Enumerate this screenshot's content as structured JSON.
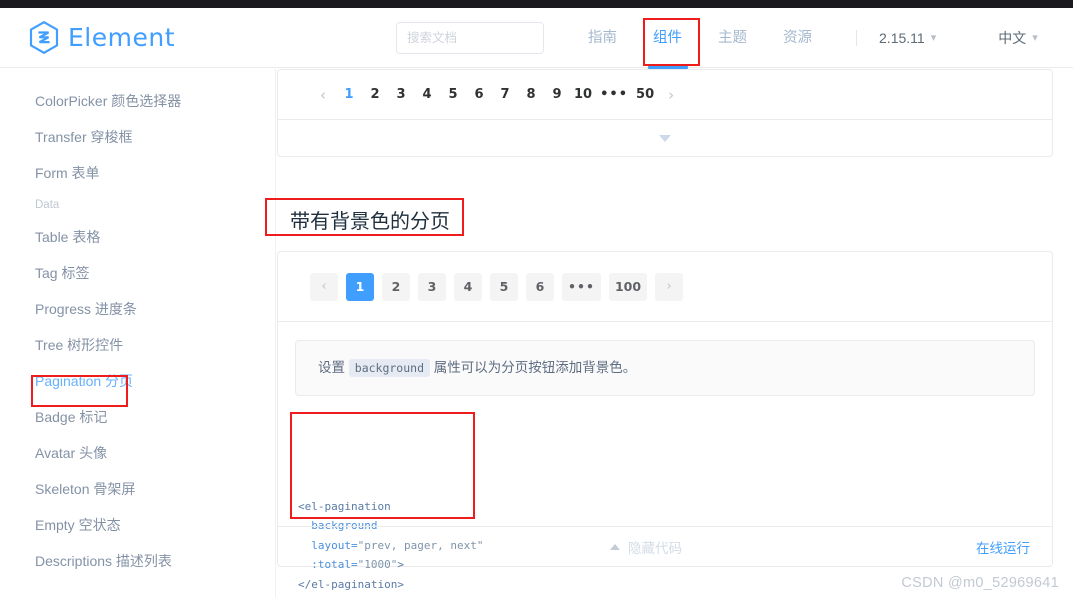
{
  "header": {
    "brand_name": "Element",
    "brand_logo_icon": "element-hexagon-logo-icon",
    "search_placeholder": "搜索文档",
    "search_value": "",
    "nav_links": [
      {
        "label": "指南",
        "active": false
      },
      {
        "label": "组件",
        "active": true
      },
      {
        "label": "主题",
        "active": false
      },
      {
        "label": "资源",
        "active": false
      }
    ],
    "version": "2.15.11",
    "language": "中文",
    "caret_icon": "chevron-down-icon"
  },
  "sidebar": {
    "items": [
      {
        "label": "",
        "type": "cut"
      },
      {
        "label": "ColorPicker 颜色选择器",
        "type": "item"
      },
      {
        "label": "Transfer 穿梭框",
        "type": "item"
      },
      {
        "label": "Form 表单",
        "type": "item"
      },
      {
        "label": "Data",
        "type": "group"
      },
      {
        "label": "Table 表格",
        "type": "item"
      },
      {
        "label": "Tag 标签",
        "type": "item"
      },
      {
        "label": "Progress 进度条",
        "type": "item"
      },
      {
        "label": "Tree 树形控件",
        "type": "item"
      },
      {
        "label": "Pagination 分页",
        "type": "item",
        "active": true
      },
      {
        "label": "Badge 标记",
        "type": "item"
      },
      {
        "label": "Avatar 头像",
        "type": "item"
      },
      {
        "label": "Skeleton 骨架屏",
        "type": "item"
      },
      {
        "label": "Empty 空状态",
        "type": "item"
      },
      {
        "label": "Descriptions 描述列表",
        "type": "item"
      }
    ]
  },
  "main": {
    "top_pager": {
      "prev_icon": "chevron-left-icon",
      "next_icon": "chevron-right-icon",
      "pages": [
        "1",
        "2",
        "3",
        "4",
        "5",
        "6",
        "7",
        "8",
        "9",
        "10",
        "•••",
        "50"
      ],
      "active_page": "1",
      "collapse_icon": "chevron-down-icon"
    },
    "section_title": "带有背景色的分页",
    "bg_pager": {
      "prev_icon": "chevron-left-icon",
      "next_icon": "chevron-right-icon",
      "pages": [
        "1",
        "2",
        "3",
        "4",
        "5",
        "6",
        "•••",
        "100"
      ],
      "active_page": "1"
    },
    "description": {
      "before": "设置",
      "code": "background",
      "after": "属性可以为分页按钮添加背景色。"
    },
    "code_lines": [
      {
        "parts": [
          {
            "t": "tag",
            "s": "<el-pagination"
          }
        ]
      },
      {
        "parts": [
          {
            "t": "attr",
            "s": "  background"
          }
        ]
      },
      {
        "parts": [
          {
            "t": "attr",
            "s": "  layout="
          },
          {
            "t": "str",
            "s": "\"prev, pager, next\""
          }
        ]
      },
      {
        "parts": [
          {
            "t": "attr",
            "s": "  :total="
          },
          {
            "t": "str",
            "s": "\"1000\""
          },
          {
            "t": "tag",
            "s": ">"
          }
        ]
      },
      {
        "parts": [
          {
            "t": "tag",
            "s": "</el-pagination>"
          }
        ]
      }
    ],
    "footer": {
      "hide_code_label": "隐藏代码",
      "hide_code_icon": "chevron-up-icon",
      "run_online_label": "在线运行"
    }
  },
  "watermark": "CSDN @m0_52969641",
  "colors": {
    "brand_blue": "#409eff",
    "annotation_red": "#ee1c1c",
    "heading": "#1f2f3d",
    "text_muted": "#8492a6"
  }
}
